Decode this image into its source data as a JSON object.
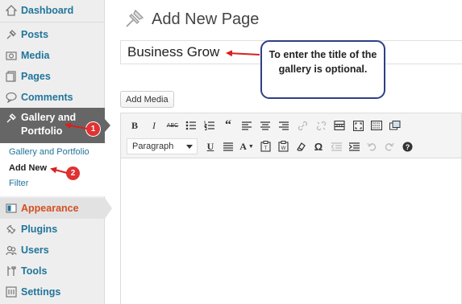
{
  "sidebar": {
    "items": [
      {
        "label": "Dashboard",
        "icon": "dashboard-icon"
      },
      {
        "label": "Posts",
        "icon": "pin-icon"
      },
      {
        "label": "Media",
        "icon": "media-icon"
      },
      {
        "label": "Pages",
        "icon": "pages-icon"
      },
      {
        "label": "Comments",
        "icon": "comments-icon"
      }
    ],
    "active": {
      "label": "Gallery and Portfolio",
      "icon": "pin-icon"
    },
    "submenu": [
      {
        "label": "Gallery and Portfolio"
      },
      {
        "label": "Add New"
      },
      {
        "label": "Filter"
      }
    ],
    "appearance": {
      "label": "Appearance",
      "icon": "appearance-icon"
    },
    "bottom_items": [
      {
        "label": "Plugins",
        "icon": "plugins-icon"
      },
      {
        "label": "Users",
        "icon": "users-icon"
      },
      {
        "label": "Tools",
        "icon": "tools-icon"
      },
      {
        "label": "Settings",
        "icon": "settings-icon"
      }
    ]
  },
  "main": {
    "title": "Add New Page",
    "title_icon": "pushpin-icon",
    "post_title_value": "Business Grow",
    "add_media_label": "Add Media",
    "format_select_value": "Paragraph"
  },
  "annotations": {
    "callout_text": "To enter the title of the gallery is optional.",
    "badge_1": "1",
    "badge_2": "2"
  },
  "colors": {
    "link": "#21759b",
    "active_bg": "#666666",
    "appearance": "#d54e21",
    "badge": "#e03232",
    "callout_border": "#2f3f85"
  }
}
